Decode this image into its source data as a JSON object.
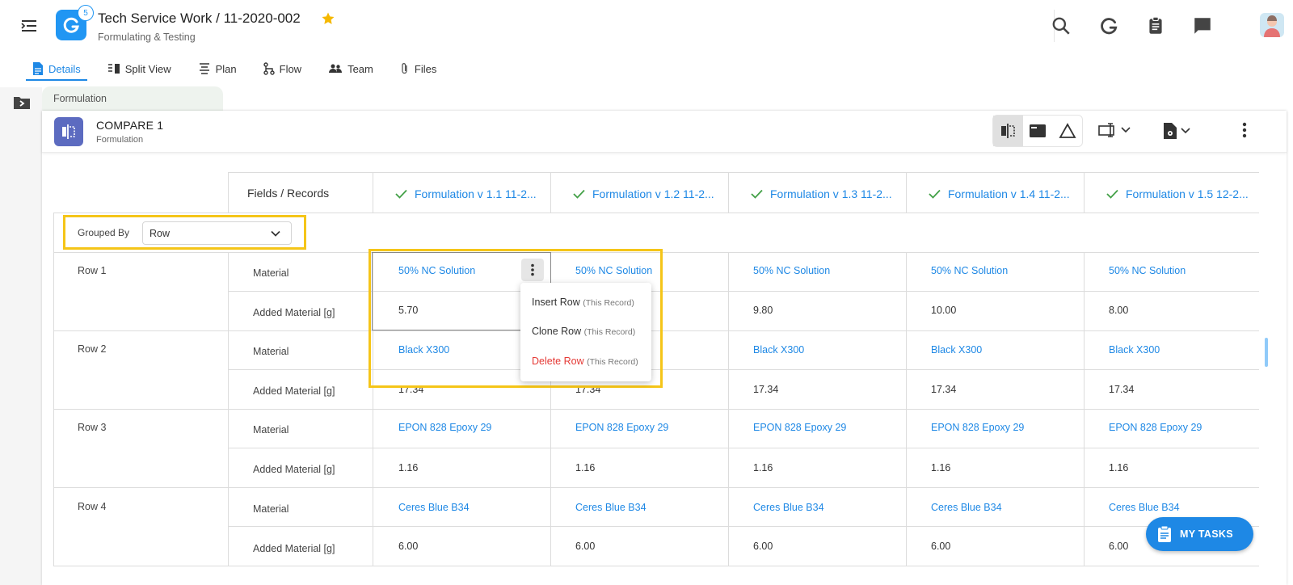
{
  "header": {
    "title": "Tech Service Work / 11-2020-002",
    "subtitle": "Formulating & Testing",
    "badge_count": "5",
    "accent_color": "#2196f3",
    "icons": [
      "search-icon",
      "activity-icon",
      "clipboard-icon",
      "chat-icon",
      "avatar"
    ]
  },
  "tabs": [
    {
      "label": "Details",
      "icon": "document-icon",
      "active": true
    },
    {
      "label": "Split View",
      "icon": "split-view-icon"
    },
    {
      "label": "Plan",
      "icon": "plan-icon"
    },
    {
      "label": "Flow",
      "icon": "flow-icon"
    },
    {
      "label": "Team",
      "icon": "team-icon"
    },
    {
      "label": "Files",
      "icon": "paperclip-icon"
    }
  ],
  "panel": {
    "tab_label": "Formulation",
    "title": "COMPARE 1",
    "subtitle": "Formulation"
  },
  "table": {
    "corner_header": "Fields / Records",
    "grouped_by_label": "Grouped By",
    "grouped_by_value": "Row",
    "columns": [
      "Formulation v 1.1 11-2...",
      "Formulation v 1.2 11-2...",
      "Formulation v 1.3 11-2...",
      "Formulation v 1.4 11-2...",
      "Formulation v 1.5 12-2..."
    ],
    "field_material": "Material",
    "field_added": "Added Material [g]",
    "rows": [
      {
        "label": "Row 1",
        "material": [
          "50% NC Solution",
          "50% NC Solution",
          "50% NC Solution",
          "50% NC Solution",
          "50% NC Solution"
        ],
        "added": [
          "5.70",
          "",
          "9.80",
          "10.00",
          "8.00"
        ]
      },
      {
        "label": "Row 2",
        "material": [
          "Black X300",
          "",
          "Black X300",
          "Black X300",
          "Black X300"
        ],
        "added": [
          "17.34",
          "17.34",
          "17.34",
          "17.34",
          "17.34"
        ]
      },
      {
        "label": "Row 3",
        "material": [
          "EPON 828 Epoxy 29",
          "EPON 828 Epoxy 29",
          "EPON 828 Epoxy 29",
          "EPON 828 Epoxy 29",
          "EPON 828 Epoxy 29"
        ],
        "added": [
          "1.16",
          "1.16",
          "1.16",
          "1.16",
          "1.16"
        ]
      },
      {
        "label": "Row 4",
        "material": [
          "Ceres Blue B34",
          "Ceres Blue B34",
          "Ceres Blue B34",
          "Ceres Blue B34",
          "Ceres Blue B34"
        ],
        "added": [
          "6.00",
          "6.00",
          "6.00",
          "6.00",
          "6.00"
        ]
      }
    ]
  },
  "context_menu": {
    "insert": "Insert Row",
    "clone": "Clone Row",
    "delete": "Delete Row",
    "hint": "(This Record)"
  },
  "my_tasks_label": "MY TASKS",
  "colors": {
    "link": "#1e88e5",
    "highlight": "#f5c518",
    "danger": "#e53935",
    "compare_icon": "#5c6bc0"
  }
}
